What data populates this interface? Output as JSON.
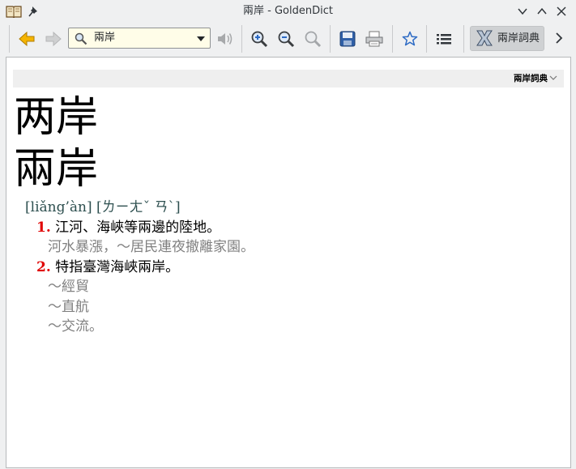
{
  "window": {
    "title": "兩岸 - GoldenDict"
  },
  "search": {
    "value": "兩岸"
  },
  "toolbar": {
    "group_label": "兩岸詞典"
  },
  "article": {
    "dict_name": "兩岸詞典",
    "headword1": "两岸",
    "headword2": "兩岸",
    "pronunciation": "[liǎng’àn] [ㄌㄧㄤˇ ㄢˋ]",
    "definitions": [
      {
        "num": "1.",
        "text": "江河、海峽等兩邊的陸地。",
        "examples": [
          "河水暴漲，～居民連夜撤離家園。"
        ]
      },
      {
        "num": "2.",
        "text": "特指臺灣海峽兩岸。",
        "examples": [
          "～經貿",
          "～直航",
          "～交流。"
        ]
      }
    ]
  },
  "colors": {
    "number": "#e00000",
    "example": "#808080",
    "pronunciation": "#2d4f4f",
    "search_bg": "#fffde8"
  }
}
